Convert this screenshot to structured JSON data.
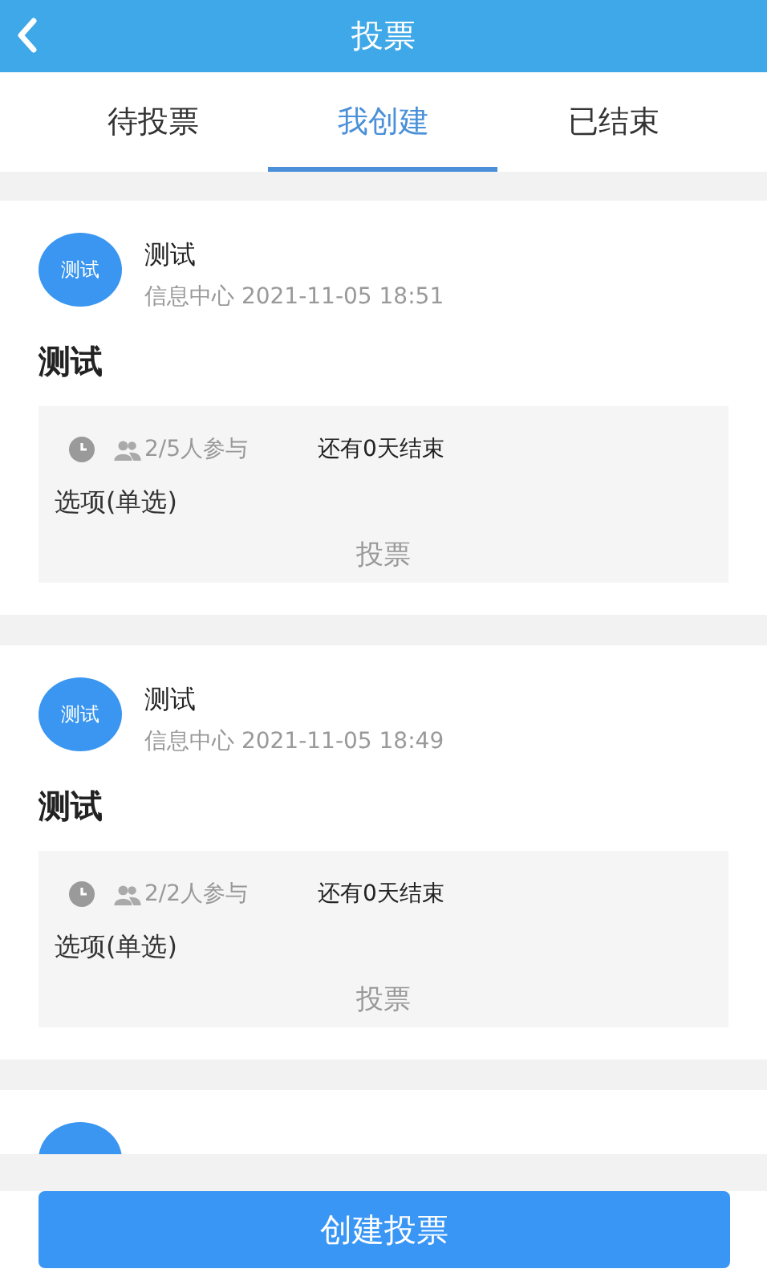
{
  "header": {
    "title": "投票"
  },
  "tabs": [
    {
      "label": "待投票",
      "selected": false
    },
    {
      "label": "我创建",
      "selected": true
    },
    {
      "label": "已结束",
      "selected": false
    }
  ],
  "votes": [
    {
      "kind": "full",
      "avatar": "测试",
      "author": "测试",
      "meta": "信息中心 2021-11-05 18:51",
      "title": "测试",
      "participants": "2/5人参与",
      "remaining": "还有0天结束",
      "option_type": "选项(单选)",
      "action": "投票"
    },
    {
      "kind": "full",
      "avatar": "测试",
      "author": "测试",
      "meta": "信息中心 2021-11-05 18:49",
      "title": "测试",
      "participants": "2/2人参与",
      "remaining": "还有0天结束",
      "option_type": "选项(单选)",
      "action": "投票"
    },
    {
      "kind": "cut_off"
    }
  ],
  "create_button": "创建投票"
}
